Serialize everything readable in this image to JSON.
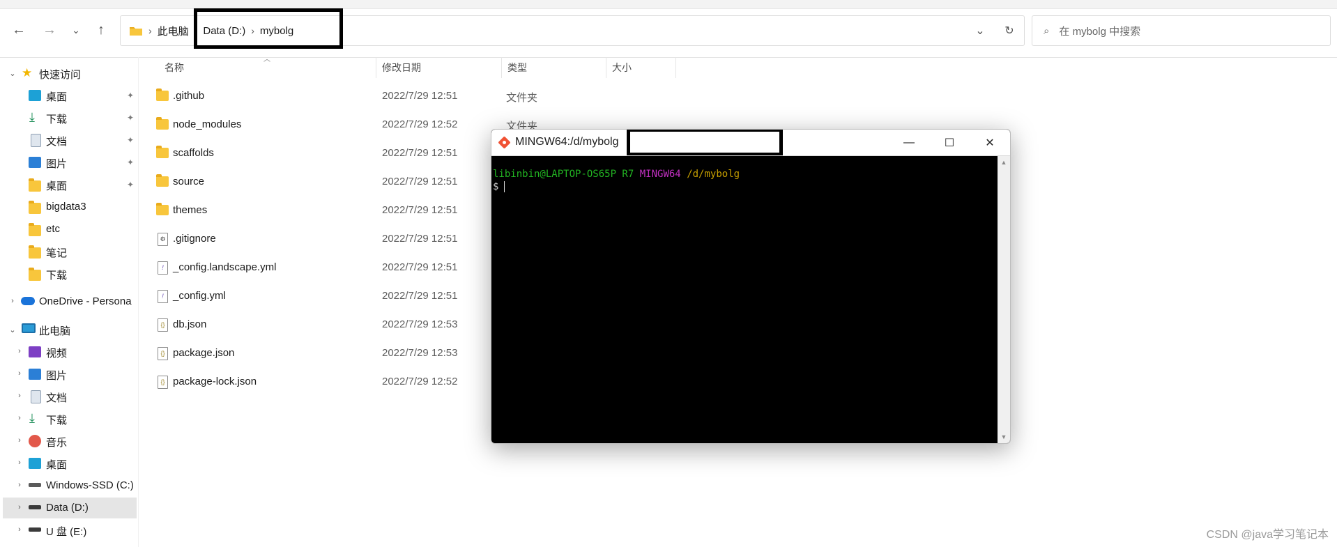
{
  "toolbar": {
    "back": "←",
    "forward": "→",
    "recent": "⌄",
    "up": "↑"
  },
  "breadcrumb": {
    "items": [
      "此电脑",
      "Data (D:)",
      "mybolg"
    ],
    "separator": "›",
    "dropdown": "⌄",
    "refresh": "↻"
  },
  "search": {
    "icon": "⌕",
    "placeholder": "在 mybolg 中搜索"
  },
  "sidebar": {
    "quick_access": "快速访问",
    "quick_items": [
      {
        "label": "桌面",
        "icon": "desktop-icon",
        "pinned": true
      },
      {
        "label": "下载",
        "icon": "download-icon",
        "pinned": true
      },
      {
        "label": "文档",
        "icon": "document-icon",
        "pinned": true
      },
      {
        "label": "图片",
        "icon": "pictures-icon",
        "pinned": true
      },
      {
        "label": "桌面",
        "icon": "folder-icon",
        "pinned": true
      },
      {
        "label": "bigdata3",
        "icon": "folder-icon",
        "pinned": false
      },
      {
        "label": "etc",
        "icon": "folder-icon",
        "pinned": false
      },
      {
        "label": "笔记",
        "icon": "folder-icon",
        "pinned": false
      },
      {
        "label": "下载",
        "icon": "folder-icon",
        "pinned": false
      }
    ],
    "onedrive": "OneDrive - Persona",
    "this_pc": "此电脑",
    "pc_items": [
      {
        "label": "视频",
        "icon": "video-icon"
      },
      {
        "label": "图片",
        "icon": "pictures-icon"
      },
      {
        "label": "文档",
        "icon": "document-icon"
      },
      {
        "label": "下载",
        "icon": "download-icon"
      },
      {
        "label": "音乐",
        "icon": "music-icon"
      },
      {
        "label": "桌面",
        "icon": "desktop-icon"
      },
      {
        "label": "Windows-SSD (C:)",
        "icon": "drive-icon"
      },
      {
        "label": "Data (D:)",
        "icon": "drive-icon",
        "selected": true
      },
      {
        "label": "U 盘 (E:)",
        "icon": "drive-icon"
      }
    ]
  },
  "columns": {
    "name": "名称",
    "date": "修改日期",
    "type": "类型",
    "size": "大小"
  },
  "files": [
    {
      "name": ".github",
      "date": "2022/7/29 12:51",
      "type": "文件夹",
      "kind": "folder"
    },
    {
      "name": "node_modules",
      "date": "2022/7/29 12:52",
      "type": "文件夹",
      "kind": "folder"
    },
    {
      "name": "scaffolds",
      "date": "2022/7/29 12:51",
      "type": "",
      "kind": "folder"
    },
    {
      "name": "source",
      "date": "2022/7/29 12:51",
      "type": "",
      "kind": "folder"
    },
    {
      "name": "themes",
      "date": "2022/7/29 12:51",
      "type": "",
      "kind": "folder"
    },
    {
      "name": ".gitignore",
      "date": "2022/7/29 12:51",
      "type": "",
      "kind": "config"
    },
    {
      "name": "_config.landscape.yml",
      "date": "2022/7/29 12:51",
      "type": "",
      "kind": "yml"
    },
    {
      "name": "_config.yml",
      "date": "2022/7/29 12:51",
      "type": "",
      "kind": "yml"
    },
    {
      "name": "db.json",
      "date": "2022/7/29 12:53",
      "type": "",
      "kind": "json"
    },
    {
      "name": "package.json",
      "date": "2022/7/29 12:53",
      "type": "",
      "kind": "json"
    },
    {
      "name": "package-lock.json",
      "date": "2022/7/29 12:52",
      "type": "",
      "kind": "json"
    }
  ],
  "terminal": {
    "title": "MINGW64:/d/mybolg",
    "minimize": "—",
    "maximize": "☐",
    "close": "✕",
    "prompt_user": "libinbin@LAPTOP-OS65P R7",
    "prompt_env": "MINGW64",
    "prompt_path": "/d/mybolg",
    "prompt_symbol": "$"
  },
  "watermark": "CSDN @java学习笔记本"
}
